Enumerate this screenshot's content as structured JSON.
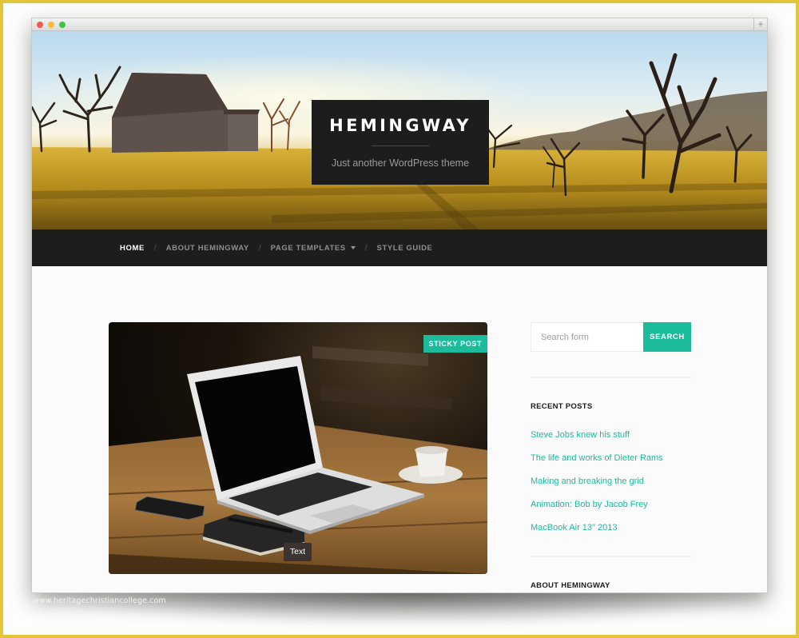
{
  "browser": {
    "new_tab_icon": "+"
  },
  "header": {
    "site_title": "HEMINGWAY",
    "tagline": "Just another WordPress theme"
  },
  "nav": {
    "items": [
      {
        "label": "HOME",
        "active": true
      },
      {
        "label": "ABOUT HEMINGWAY",
        "active": false
      },
      {
        "label": "PAGE TEMPLATES",
        "active": false,
        "has_dropdown": true
      },
      {
        "label": "STYLE GUIDE",
        "active": false
      }
    ],
    "separator": "/"
  },
  "post": {
    "badge": "STICKY POST",
    "tooltip": "Text"
  },
  "sidebar": {
    "search": {
      "placeholder": "Search form",
      "value": "",
      "button_label": "SEARCH"
    },
    "recent_posts": {
      "title": "RECENT POSTS",
      "items": [
        "Steve Jobs knew his stuff",
        "The life and works of Dieter Rams",
        "Making and breaking the grid",
        "Animation: Bob by Jacob Frey",
        "MacBook Air 13″ 2013"
      ]
    },
    "about": {
      "title": "ABOUT HEMINGWAY"
    }
  },
  "watermark": "www.heritagechristiancollege.com",
  "colors": {
    "accent": "#1abc9c",
    "dark": "#1d1d1d",
    "frame": "#e3c53a"
  }
}
